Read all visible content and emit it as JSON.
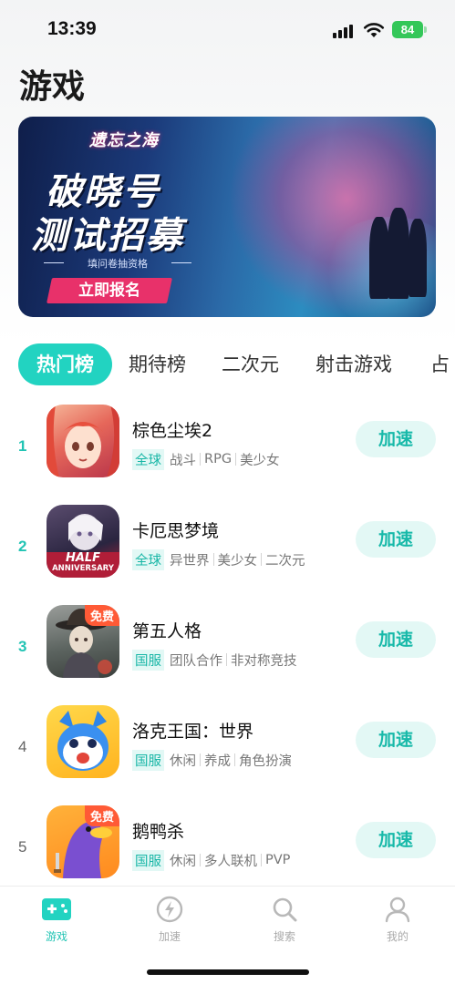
{
  "status_bar": {
    "time": "13:39",
    "battery": "84"
  },
  "page_title": "游戏",
  "banner": {
    "logo_text": "遗忘之海",
    "headline_line1": "破晓号",
    "headline_line2": "测试招募",
    "subtitle": "填问卷抽资格",
    "cta": "立即报名"
  },
  "tabs": [
    {
      "label": "热门榜",
      "active": true
    },
    {
      "label": "期待榜",
      "active": false
    },
    {
      "label": "二次元",
      "active": false
    },
    {
      "label": "射击游戏",
      "active": false
    },
    {
      "label": "占",
      "active": false
    }
  ],
  "games": [
    {
      "rank": "1",
      "name": "棕色尘埃2",
      "region": "全球",
      "tags": [
        "战斗",
        "RPG",
        "美少女"
      ],
      "badge": "",
      "action": "加速"
    },
    {
      "rank": "2",
      "name": "卡厄思梦境",
      "region": "全球",
      "tags": [
        "异世界",
        "美少女",
        "二次元"
      ],
      "badge": "",
      "icon_text_1": "HALF",
      "icon_text_2": "ANNIVERSARY",
      "action": "加速"
    },
    {
      "rank": "3",
      "name": "第五人格",
      "region": "国服",
      "tags": [
        "团队合作",
        "非对称竞技"
      ],
      "badge": "免费",
      "action": "加速"
    },
    {
      "rank": "4",
      "name": "洛克王国：世界",
      "region": "国服",
      "tags": [
        "休闲",
        "养成",
        "角色扮演"
      ],
      "badge": "",
      "action": "加速"
    },
    {
      "rank": "5",
      "name": "鹅鸭杀",
      "region": "国服",
      "tags": [
        "休闲",
        "多人联机",
        "PVP"
      ],
      "badge": "免费",
      "action": "加速"
    }
  ],
  "bottom_nav": [
    {
      "label": "游戏",
      "icon": "gamepad-icon",
      "active": true
    },
    {
      "label": "加速",
      "icon": "lightning-icon",
      "active": false
    },
    {
      "label": "搜索",
      "icon": "search-icon",
      "active": false
    },
    {
      "label": "我的",
      "icon": "person-icon",
      "active": false
    }
  ],
  "colors": {
    "accent": "#22d3c1",
    "accent_text": "#17b9a9",
    "accent_bg": "#e3f8f5",
    "badge": "#ff5a36"
  }
}
